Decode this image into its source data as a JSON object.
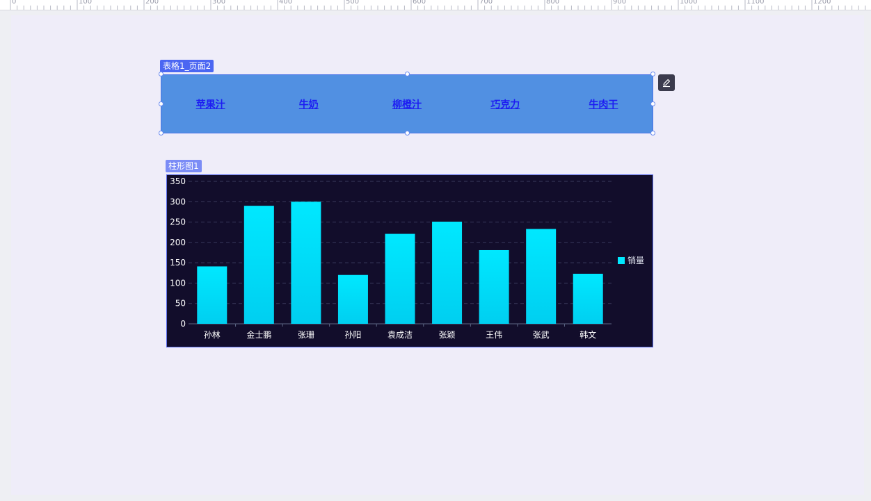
{
  "ruler": {
    "labels": [
      "0",
      "100",
      "200",
      "300",
      "400",
      "500",
      "600",
      "700",
      "800",
      "900",
      "1000",
      "1100",
      "1200"
    ]
  },
  "table_component": {
    "tag": "表格1_页面2",
    "columns": [
      "苹果汁",
      "牛奶",
      "柳橙汁",
      "巧克力",
      "牛肉干"
    ],
    "edit_icon": "pencil-icon"
  },
  "chart_component": {
    "tag": "柱形图1"
  },
  "chart_data": {
    "type": "bar",
    "categories": [
      "孙林",
      "金士鹏",
      "张珊",
      "孙阳",
      "袁成洁",
      "张颖",
      "王伟",
      "张武",
      "韩文"
    ],
    "series": [
      {
        "name": "销量",
        "values": [
          141,
          290,
          300,
          120,
          221,
          251,
          181,
          233,
          123
        ]
      }
    ],
    "ylim": [
      0,
      350
    ],
    "yticks": [
      "0",
      "50",
      "100",
      "150",
      "200",
      "250",
      "300",
      "350"
    ],
    "grid": true,
    "legend": "right",
    "colors": {
      "bar_top": "#00e8ff",
      "bar_bottom": "#00cff0",
      "background": "#120d2b",
      "text": "#ffffff"
    }
  }
}
